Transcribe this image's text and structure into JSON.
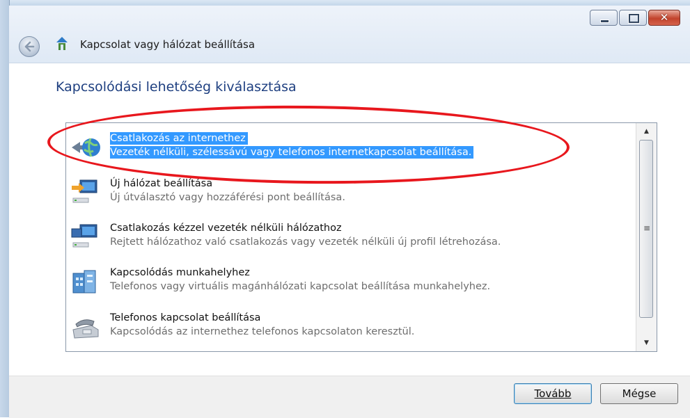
{
  "window": {
    "title": "Kapcsolat vagy hálózat beállítása",
    "close_glyph": "✕"
  },
  "page": {
    "heading": "Kapcsolódási lehetőség kiválasztása"
  },
  "options": [
    {
      "title": "Csatlakozás az internethez",
      "desc": "Vezeték nélküli, szélessávú vagy telefonos internetkapcsolat beállítása.",
      "icon": "globe-network-icon",
      "selected": true
    },
    {
      "title": "Új hálózat beállítása",
      "desc": "Új útválasztó vagy hozzáférési pont beállítása.",
      "icon": "new-network-icon",
      "selected": false
    },
    {
      "title": "Csatlakozás kézzel vezeték nélküli hálózathoz",
      "desc": "Rejtett hálózathoz való csatlakozás vagy vezeték nélküli új profil létrehozása.",
      "icon": "wireless-network-icon",
      "selected": false
    },
    {
      "title": "Kapcsolódás munkahelyhez",
      "desc": "Telefonos vagy virtuális magánhálózati kapcsolat beállítása munkahelyhez.",
      "icon": "workplace-building-icon",
      "selected": false
    },
    {
      "title": "Telefonos kapcsolat beállítása",
      "desc": "Kapcsolódás az internethez telefonos kapcsolaton keresztül.",
      "icon": "dialup-phone-icon",
      "selected": false
    }
  ],
  "scrollbar": {
    "up": "▲",
    "down": "▼",
    "grip": "≡"
  },
  "buttons": {
    "next": "Tovább",
    "cancel": "Mégse"
  },
  "colors": {
    "accent_selection": "#3399ff",
    "heading": "#1e3f80",
    "annotation_ellipse": "#e8171d"
  }
}
